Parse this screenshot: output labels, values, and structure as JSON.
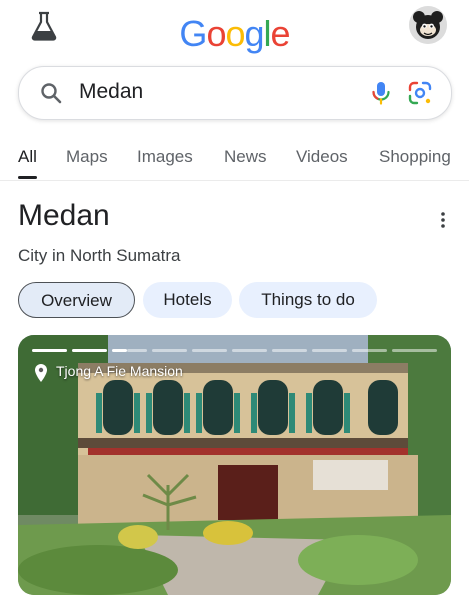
{
  "logo": {
    "letters": [
      "G",
      "o",
      "o",
      "g",
      "l",
      "e"
    ],
    "colors": [
      "#4285F4",
      "#EA4335",
      "#FBBC05",
      "#4285F4",
      "#34A853",
      "#EA4335"
    ]
  },
  "search": {
    "query": "Medan"
  },
  "tabs": [
    {
      "label": "All",
      "active": true
    },
    {
      "label": "Maps"
    },
    {
      "label": "Images"
    },
    {
      "label": "News"
    },
    {
      "label": "Videos"
    },
    {
      "label": "Shopping"
    }
  ],
  "result": {
    "title": "Medan",
    "subtitle": "City in North Sumatra",
    "chips": [
      "Overview",
      "Hotels",
      "Things to do"
    ],
    "photo": {
      "caption": "Tjong A Fie Mansion",
      "slides_total": 13,
      "slides_viewed": 3
    }
  },
  "colors": {
    "accent": "#1a73e8",
    "chip_bg": "#e8f0fe"
  }
}
